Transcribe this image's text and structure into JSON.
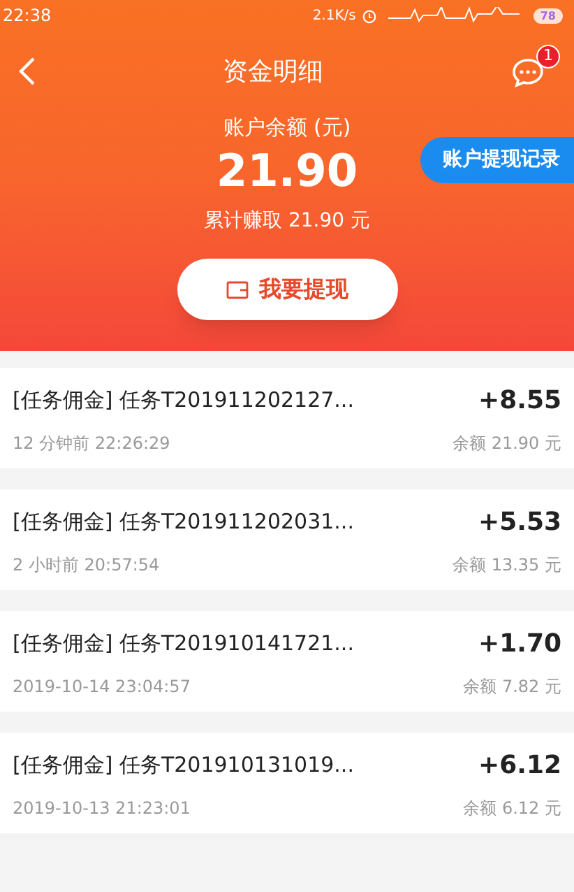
{
  "status_bar": {
    "time": "22:38",
    "speed": "2.1K/s",
    "battery": "78"
  },
  "header": {
    "title": "资金明细",
    "badge": "1"
  },
  "balance": {
    "label": "账户余额 (元)",
    "amount": "21.90",
    "total": "累计赚取 21.90 元",
    "record_button": "账户提现记录",
    "withdraw_button": "我要提现"
  },
  "transactions": [
    {
      "title": "[任务佣金] 任务T201911202127...",
      "time": "12 分钟前 22:26:29",
      "amount": "+8.55",
      "balance": "余额 21.90 元"
    },
    {
      "title": "[任务佣金] 任务T201911202031...",
      "time": "2 小时前 20:57:54",
      "amount": "+5.53",
      "balance": "余额 13.35 元"
    },
    {
      "title": "[任务佣金] 任务T201910141721...",
      "time": "2019-10-14 23:04:57",
      "amount": "+1.70",
      "balance": "余额 7.82 元"
    },
    {
      "title": "[任务佣金] 任务T201910131019...",
      "time": "2019-10-13 21:23:01",
      "amount": "+6.12",
      "balance": "余额 6.12 元"
    }
  ]
}
